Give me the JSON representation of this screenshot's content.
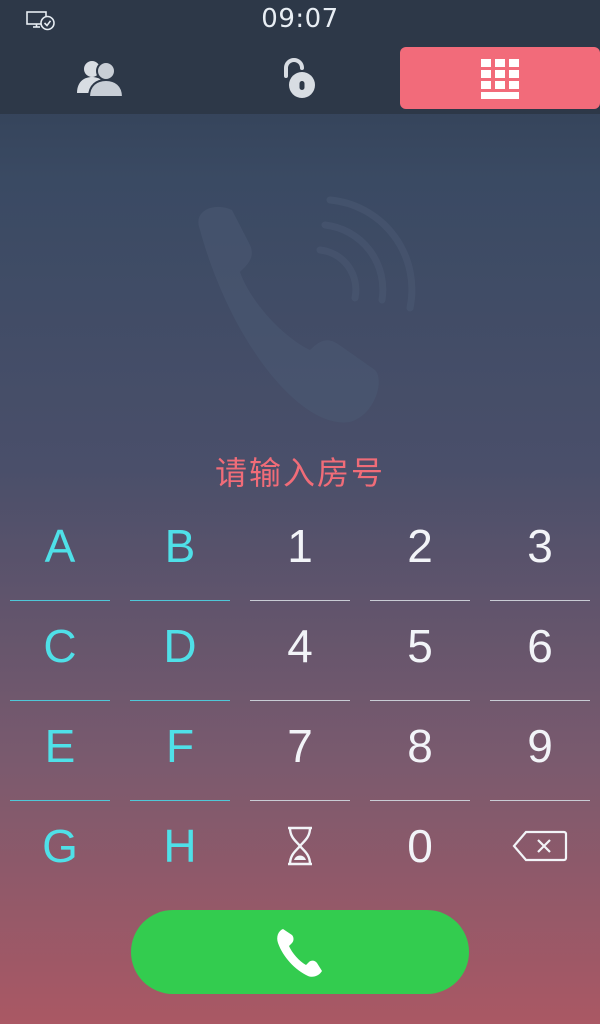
{
  "status_bar": {
    "time": "09:07",
    "icon": "monitor-check-icon"
  },
  "tabs": [
    {
      "name": "contacts",
      "icon": "contacts-icon",
      "active": false
    },
    {
      "name": "unlock",
      "icon": "unlock-icon",
      "active": false
    },
    {
      "name": "dialpad",
      "icon": "keypad-grid-icon",
      "active": true
    }
  ],
  "prompt": "请输入房号",
  "keypad": {
    "rows": [
      [
        "A",
        "B",
        "1",
        "2",
        "3"
      ],
      [
        "C",
        "D",
        "4",
        "5",
        "6"
      ],
      [
        "E",
        "F",
        "7",
        "8",
        "9"
      ],
      [
        "G",
        "H",
        "",
        "0",
        ""
      ]
    ],
    "special_keys": {
      "hourglass": "hourglass-icon",
      "backspace": "backspace-icon"
    }
  },
  "call_button": {
    "icon": "phone-icon"
  },
  "colors": {
    "accent": "#f26b7a",
    "prompt": "#f06c78",
    "letter_keys": "#4fe0e8",
    "call": "#33cc4f",
    "bar": "#2d3848"
  }
}
